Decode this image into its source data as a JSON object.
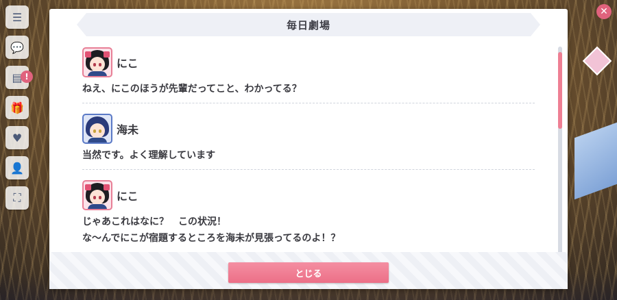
{
  "dialog": {
    "title": "毎日劇場",
    "close_label": "とじる"
  },
  "messages": [
    {
      "speaker": "にこ",
      "avatar": "nico-avatar",
      "lines": [
        "ねえ、にこのほうが先輩だってこと、わかってる？"
      ]
    },
    {
      "speaker": "海未",
      "avatar": "umi-avatar",
      "lines": [
        "当然です。よく理解しています"
      ]
    },
    {
      "speaker": "にこ",
      "avatar": "nico-avatar",
      "lines": [
        "じゃあこれはなに？　この状況！",
        "な～んでにこが宿題するところを海未が見張ってるのよ！？"
      ]
    }
  ],
  "scroll": {
    "position_fraction": 0.03
  },
  "colors": {
    "accent": "#ec6f87",
    "text": "#3a3a40",
    "title_bg": "#eef0f6"
  },
  "background": {
    "rail_icons": [
      "menu-icon",
      "chat-icon",
      "present-icon",
      "gift-icon",
      "heart-icon",
      "members-icon",
      "fullscreen-icon"
    ]
  }
}
